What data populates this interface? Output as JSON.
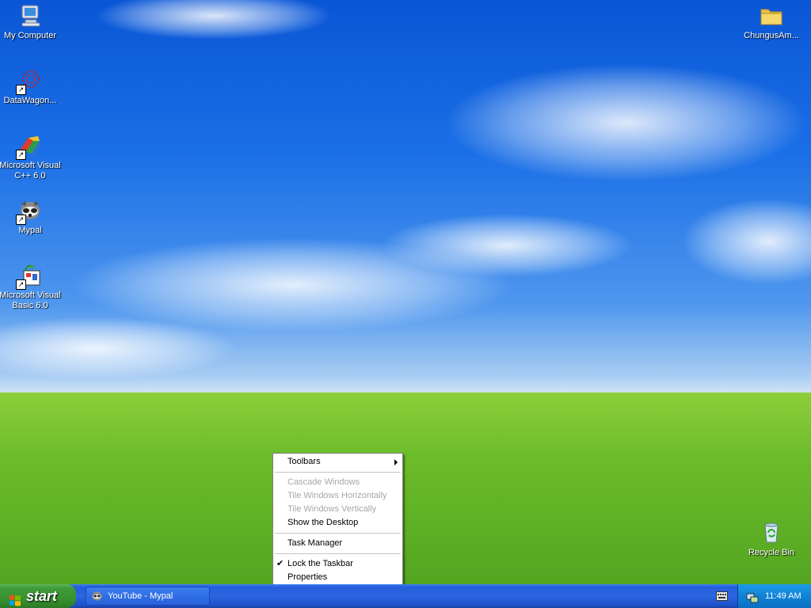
{
  "desktop": {
    "icons": [
      {
        "label": "My Computer",
        "icon": "my-computer-icon"
      },
      {
        "label": "DataWagon...",
        "icon": "datawagon-icon"
      },
      {
        "label": "Microsoft Visual\nC++ 6.0",
        "icon": "visual-cpp-icon"
      },
      {
        "label": "Mypal",
        "icon": "mypal-icon"
      },
      {
        "label": "Microsoft Visual\nBasic 6.0",
        "icon": "visual-basic-icon"
      },
      {
        "label": "ChungusAm...",
        "icon": "folder-icon"
      },
      {
        "label": "Recycle Bin",
        "icon": "recycle-bin-icon"
      }
    ]
  },
  "context_menu": {
    "items": [
      {
        "label": "Toolbars",
        "submenu": true
      },
      {
        "label": "Cascade Windows",
        "disabled": true
      },
      {
        "label": "Tile Windows Horizontally",
        "disabled": true
      },
      {
        "label": "Tile Windows Vertically",
        "disabled": true
      },
      {
        "label": "Show the Desktop"
      },
      {
        "label": "Task Manager"
      },
      {
        "label": "Lock the Taskbar",
        "checked": true
      },
      {
        "label": "Properties"
      }
    ],
    "check_mark": "✔"
  },
  "taskbar": {
    "start_label": "start",
    "tasks": [
      {
        "label": "YouTube - Mypal",
        "icon": "mypal-icon"
      }
    ],
    "clock": "11:49 AM"
  },
  "colors": {
    "taskbar_blue": "#245edb",
    "start_green": "#3f9d3a",
    "tray_blue": "#0f84d8"
  }
}
